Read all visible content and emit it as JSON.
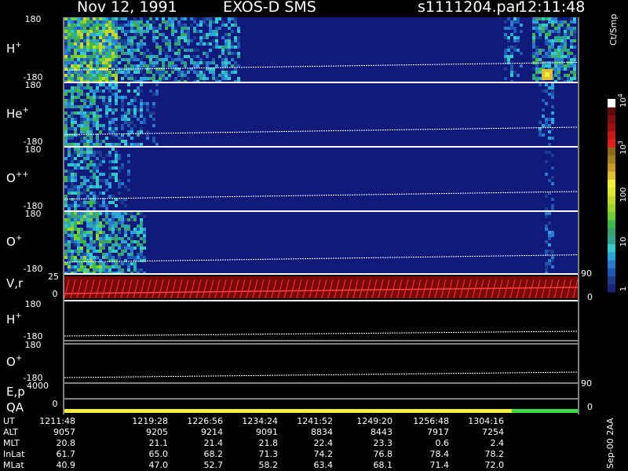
{
  "header": {
    "date": "Nov 12, 1991",
    "instrument": "EXOS-D SMS",
    "file": "s1111204.par",
    "time": "12:11:48"
  },
  "colorbar": {
    "title": "Ct/Smp",
    "ticks": [
      "1",
      "10",
      "100",
      "10",
      "10"
    ],
    "tick_sups": [
      "",
      "",
      "",
      "3",
      "4"
    ],
    "colors": [
      "#1a237e",
      "#1e3c8c",
      "#1e58b4",
      "#2a7ad0",
      "#2aa7d8",
      "#36c9c9",
      "#2fa58f",
      "#3aa16a",
      "#3fb84a",
      "#6fcd35",
      "#99d52a",
      "#c7d82a",
      "#e0e82f",
      "#f2ee3a",
      "#e0c030",
      "#c89a2a",
      "#a6801e",
      "#8c6a1a",
      "#e22020",
      "#c81818",
      "#a01010",
      "#801010",
      "#600a0a",
      "#ffffff"
    ]
  },
  "panels": [
    {
      "label": "H",
      "sup": "+",
      "top": "180",
      "bottom": "-180"
    },
    {
      "label": "He",
      "sup": "+",
      "top": "180",
      "bottom": "-180"
    },
    {
      "label": "O",
      "sup": "++",
      "top": "180",
      "bottom": "-180"
    },
    {
      "label": "O",
      "sup": "+",
      "top": "180",
      "bottom": "-180",
      "right_tick": "90"
    }
  ],
  "line_panels": [
    {
      "label": "V,r",
      "sup": "",
      "top": "25",
      "bottom": "0",
      "right": "0"
    },
    {
      "label": "H",
      "sup": "+",
      "top": "180",
      "bottom": "-180"
    },
    {
      "label": "O",
      "sup": "+",
      "top": "180",
      "bottom": "-180"
    },
    {
      "label": "E,p",
      "sup": "",
      "top": "4000",
      "right": "90"
    },
    {
      "label": "QA",
      "sup": "",
      "bottom": "0",
      "right": "0"
    }
  ],
  "footer": {
    "rows": [
      {
        "label": "UT",
        "values": [
          "1211:48",
          "1219:28",
          "1226:56",
          "1234:24",
          "1241:52",
          "1249:20",
          "1256:48",
          "1304:16"
        ]
      },
      {
        "label": "ALT",
        "values": [
          "9057",
          "9205",
          "9214",
          "9091",
          "8834",
          "8443",
          "7917",
          "7254"
        ]
      },
      {
        "label": "MLT",
        "values": [
          "20.8",
          "21.1",
          "21.4",
          "21.8",
          "22.4",
          "23.3",
          "0.6",
          "2.4"
        ]
      },
      {
        "label": "InLat",
        "values": [
          "61.7",
          "65.0",
          "68.2",
          "71.3",
          "74.2",
          "76.8",
          "78.4",
          "78.2"
        ]
      },
      {
        "label": "MLat",
        "values": [
          "40.9",
          "47.0",
          "52.7",
          "58.2",
          "63.4",
          "68.1",
          "71.4",
          "72.0"
        ]
      }
    ]
  },
  "version": "Sep-00 2AA",
  "chart_data": {
    "type": "heatmap",
    "title": "Nov 12, 1991   EXOS-D SMS",
    "x_ticks": [
      "1211:48",
      "1219:28",
      "1226:56",
      "1234:24",
      "1241:52",
      "1249:20",
      "1256:48",
      "1304:16"
    ],
    "species": [
      "H+",
      "He+",
      "O++",
      "O+"
    ],
    "ylim": [
      -180,
      180
    ],
    "colorbar_label": "Ct/Smp",
    "colorbar_scale": "log",
    "colorbar_range": [
      1,
      10000
    ]
  }
}
